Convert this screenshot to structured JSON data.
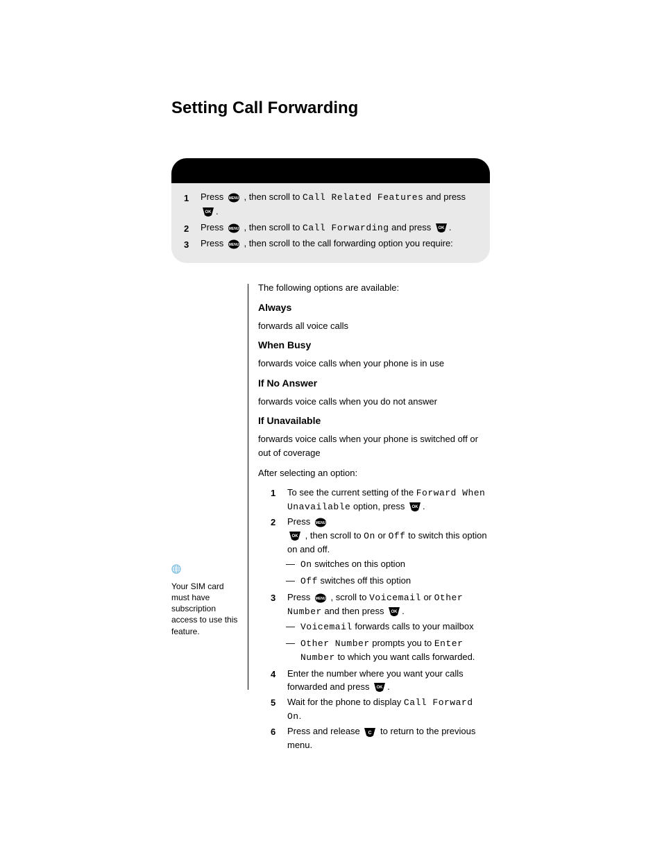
{
  "heading": "Setting Call Forwarding",
  "box": {
    "step1_prefix": "Press ",
    "step1_mid": ", then scroll to ",
    "step1_label": "Call Related Features",
    "step1_suffix": " and press ",
    "step2_prefix": "Press ",
    "step2_mid": ", then scroll to ",
    "step2_label": "Call Forwarding",
    "step2_suffix": " and press ",
    "step3_prefix": "Press ",
    "step3_mid": ", then scroll to the call forwarding option you require:"
  },
  "options_intro": "The following options are available:",
  "options": {
    "always_title": "Always",
    "always_body": "forwards all voice calls",
    "busy_title": "When Busy",
    "busy_body": "forwards voice calls when your phone is in use",
    "noans_title": "If No Answer",
    "noans_body": "forwards voice calls when you do not answer",
    "unavail_title": "If Unavailable",
    "unavail_body": "forwards voice calls when your phone is switched off or out of coverage"
  },
  "after_intro": "After selecting an option:",
  "sub": {
    "s1_prefix": "To see the current setting of the ",
    "s1_label": "Forward When Unavailable",
    "s1_mid": " option, press ",
    "s2_prefix": "Press ",
    "s2_mid": ", then scroll to ",
    "s2_on": "On",
    "s2_or": " or ",
    "s2_off": "Off",
    "s2_suffix": " to switch this option on and off.",
    "b_on_label": "On",
    "b_on_body": " switches on this option",
    "b_off_label": "Off",
    "b_off_body": " switches off this option",
    "s3_prefix": "Press ",
    "s3_mid": ", scroll to ",
    "s3_vm": "Voicemail",
    "s3_or": " or ",
    "s3_other": "Other Number",
    "s3_suffix": " and then press ",
    "b_vm_label": "Voicemail",
    "b_vm_body": " forwards calls to your mailbox",
    "b_other_label": "Other Number",
    "b_other_body": " prompts you to ",
    "b_other_enter": "Enter Number",
    "b_other_body2": " to which you want calls forwarded.",
    "s4_body": "Enter the number where you want your calls forwarded and press ",
    "s5_prefix": "Wait for the phone to display ",
    "s5_label": "Call Forward On",
    "s6_body": "Press and release ",
    "s6_suffix": " to return to the previous menu."
  },
  "sidebar": {
    "text": "Your SIM card must have subscription access to use this feature."
  }
}
